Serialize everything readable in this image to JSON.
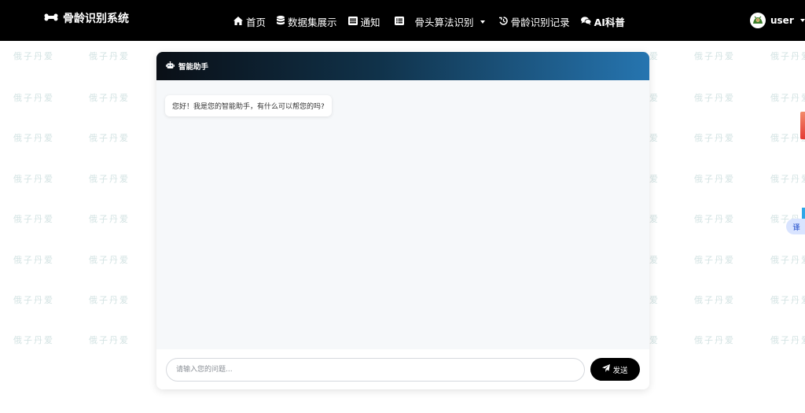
{
  "brand": {
    "title": "骨龄识别系统",
    "icon": "bone-icon"
  },
  "nav": {
    "home": "首页",
    "dataset": "数据集展示",
    "notice": "通知",
    "algorithm": "骨头算法识别",
    "records": "骨龄识别记录",
    "ai": "AI科普"
  },
  "user": {
    "name": "user"
  },
  "watermark": {
    "text": "俄子丹爱"
  },
  "chat": {
    "title": "智能助手",
    "greeting": "您好！我是您的智能助手，有什么可以帮您的吗?",
    "input_placeholder": "请输入您的问题...",
    "send_label": "发送"
  },
  "translate": {
    "label": "译"
  },
  "colors": {
    "navbar": "#000000",
    "header_gradient_start": "#0a0f16",
    "header_gradient_end": "#2675b0",
    "send_button": "#000000"
  }
}
